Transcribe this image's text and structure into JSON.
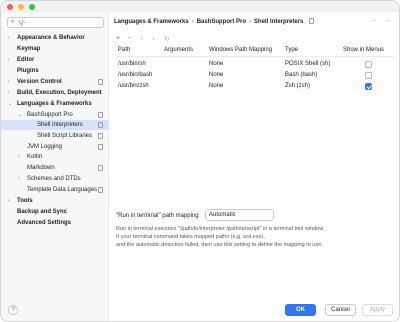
{
  "search": {
    "placeholder": "Q-",
    "value": ""
  },
  "sidebar": {
    "items": [
      {
        "label": "Appearance & Behavior",
        "chevron": "›",
        "bold": true
      },
      {
        "label": "Keymap",
        "chevron": "",
        "bold": true
      },
      {
        "label": "Editor",
        "chevron": "›",
        "bold": true
      },
      {
        "label": "Plugins",
        "chevron": "",
        "bold": true
      },
      {
        "label": "Version Control",
        "chevron": "›",
        "bold": true
      },
      {
        "label": "Build, Execution, Deployment",
        "chevron": "›",
        "bold": true
      },
      {
        "label": "Languages & Frameworks",
        "chevron": "⌄",
        "bold": true
      },
      {
        "label": "BashSupport Pro",
        "chevron": "⌄",
        "bold": false
      },
      {
        "label": "Shell Interpreters",
        "chevron": "",
        "bold": false
      },
      {
        "label": "Shell Script Libraries",
        "chevron": "",
        "bold": false
      },
      {
        "label": "JVM Logging",
        "chevron": "",
        "bold": false
      },
      {
        "label": "Kotlin",
        "chevron": "›",
        "bold": false
      },
      {
        "label": "Markdown",
        "chevron": "",
        "bold": false
      },
      {
        "label": "Schemes and DTDs",
        "chevron": "›",
        "bold": false
      },
      {
        "label": "Template Data Languages",
        "chevron": "",
        "bold": false
      },
      {
        "label": "Tools",
        "chevron": "›",
        "bold": true
      },
      {
        "label": "Backup and Sync",
        "chevron": "",
        "bold": true
      },
      {
        "label": "Advanced Settings",
        "chevron": "",
        "bold": true
      }
    ]
  },
  "breadcrumb": {
    "parts": [
      "Languages & Frameworks",
      "BashSupport Pro",
      "Shell Interpreters"
    ],
    "separator": "›"
  },
  "nav": {
    "back": "←",
    "forward": "→"
  },
  "toolbar": {
    "add": "+",
    "remove": "−",
    "up": "↑",
    "down": "↓",
    "refresh": "↻"
  },
  "table": {
    "columns": [
      "Path",
      "Arguments",
      "Windows Path Mapping",
      "Type",
      "Show in Menus"
    ],
    "rows": [
      {
        "path": "/usr/bin/sh",
        "arguments": "",
        "mapping": "None",
        "type": "POSIX Shell (sh)",
        "show": false
      },
      {
        "path": "/usr/bin/bash",
        "arguments": "",
        "mapping": "None",
        "type": "Bash (bash)",
        "show": false
      },
      {
        "path": "/usr/bin/zsh",
        "arguments": "",
        "mapping": "None",
        "type": "Zsh (zsh)",
        "show": true
      }
    ]
  },
  "mapping": {
    "label": "\"Run in terminal\" path mapping",
    "value": "Automatic",
    "help": [
      "Run in terminal executes \"/path/to/interpreter /path/to/script\" in a terminal tool window.",
      "If your terminal command takes mapped paths (e.g. wsl.exe),",
      "and the automatic detection failed, then use this setting to define the mapping to use."
    ]
  },
  "buttons": {
    "ok": "OK",
    "cancel": "Cancel",
    "apply": "Apply",
    "help": "?"
  },
  "colors": {
    "accent": "#3574f0",
    "selection": "#d5e1ff"
  }
}
